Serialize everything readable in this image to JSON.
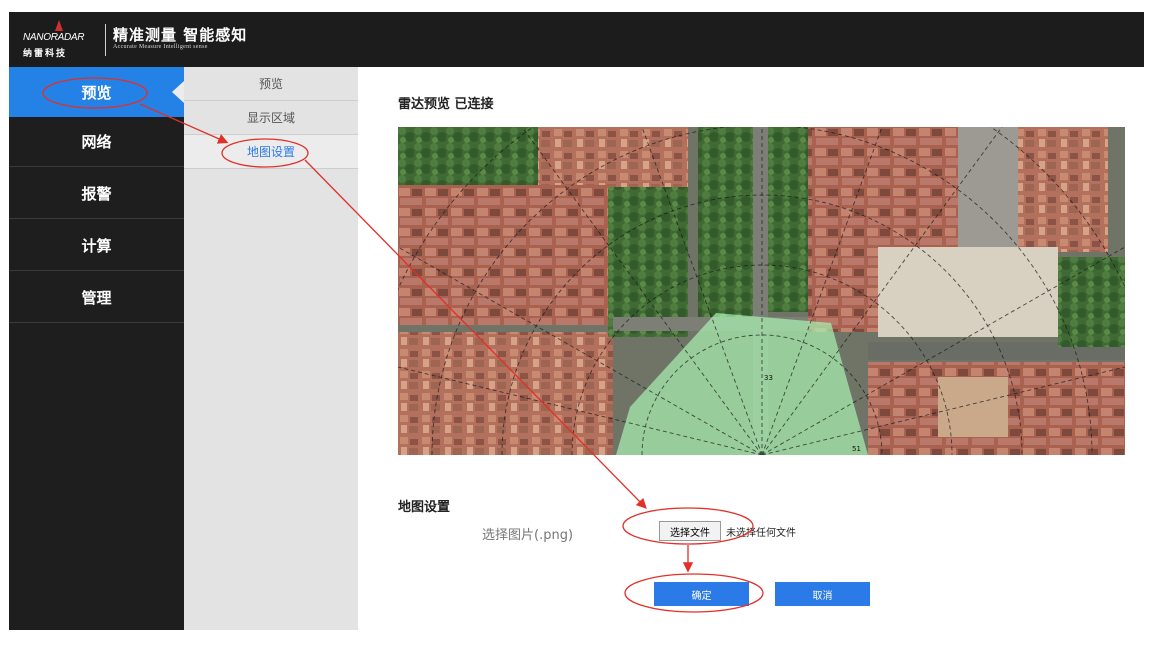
{
  "header": {
    "logo_en": "NANORADAR",
    "logo_cn": "纳雷科技",
    "slogan_cn": "精准测量 智能感知",
    "slogan_en": "Accurate Measure   Intelligent sense"
  },
  "sidebar": {
    "items": [
      {
        "label": "预览",
        "active": true
      },
      {
        "label": "网络",
        "active": false
      },
      {
        "label": "报警",
        "active": false
      },
      {
        "label": "计算",
        "active": false
      },
      {
        "label": "管理",
        "active": false
      }
    ]
  },
  "subnav": {
    "items": [
      {
        "label": "预览",
        "active": false
      },
      {
        "label": "显示区域",
        "active": false
      },
      {
        "label": "地图设置",
        "active": true
      }
    ]
  },
  "main": {
    "preview_title": "雷达预览 已连接",
    "map_settings_title": "地图设置",
    "choose_image_label": "选择图片(.png)",
    "choose_file_button": "选择文件",
    "file_status": "未选择任何文件",
    "confirm_button": "确定",
    "cancel_button": "取消"
  },
  "map": {
    "range_labels": [
      "33",
      "51"
    ]
  },
  "colors": {
    "accent": "#2481e6",
    "topbar": "#1c1c1c",
    "sidebar": "#1e1e1e",
    "subnav": "#e3e3e3",
    "annotation": "#e0302a",
    "radar_zone": "#a8f0b0"
  }
}
